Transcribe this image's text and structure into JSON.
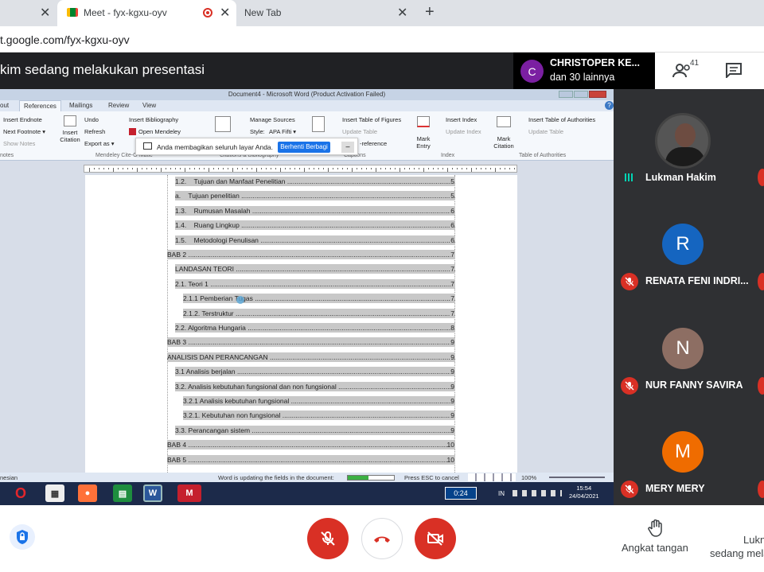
{
  "browser": {
    "tabs": [
      {
        "label": "",
        "active": false
      },
      {
        "label": "Meet - fyx-kgxu-oyv",
        "active": true
      },
      {
        "label": "New Tab",
        "active": false
      }
    ],
    "close_glyph": "✕",
    "new_tab_glyph": "+",
    "address": "t.google.com/fyx-kgxu-oyv"
  },
  "meet": {
    "presenting_title": "kim sedang melakukan presentasi",
    "presenter_chip": {
      "avatar_letter": "C",
      "name": "CHRISTOPER KE...",
      "sub": "dan 30 lainnya",
      "color": "#7b1fa2"
    },
    "participant_count": "41",
    "participants": [
      {
        "name": "Lukman Hakim",
        "avatar_letter": "",
        "color": "#444",
        "muted": false
      },
      {
        "name": "RENATA FENI INDRI...",
        "avatar_letter": "R",
        "color": "#1565c0",
        "muted": true
      },
      {
        "name": "NUR FANNY SAVIRA",
        "avatar_letter": "N",
        "color": "#8d6e63",
        "muted": true
      },
      {
        "name": "MERY MERY",
        "avatar_letter": "M",
        "color": "#ef6c00",
        "muted": true
      }
    ],
    "raise_hand_label": "Angkat tangan",
    "right_clip_line1": "Lukn",
    "right_clip_line2": "sedang mela"
  },
  "word": {
    "title": "Document4 - Microsoft Word (Product Activation Failed)",
    "tabs": [
      "out",
      "References",
      "Mailings",
      "Review",
      "View"
    ],
    "ribbon": {
      "insert_endnote": "Insert Endnote",
      "next_footnote": "Next Footnote ▾",
      "show_notes": "Show Notes",
      "group_footnotes": "notes",
      "insert_citation": "Insert Citation",
      "undo": "Undo",
      "refresh": "Refresh",
      "export_as": "Export as ▾",
      "insert_bibliography": "Insert Bibliography",
      "open_mendeley": "Open Mendeley",
      "group_mendeley": "Mendeley Cite-O-Matic",
      "manage_sources": "Manage Sources",
      "style": "Style:",
      "style_value": "APA Fifti ▾",
      "group_citations": "Citations & Bibliography",
      "insert_table_of_figures": "Insert Table of Figures",
      "update_table": "Update Table",
      "cross_reference": "-reference",
      "group_captions": "Captions",
      "mark_entry": "Mark Entry",
      "insert_index": "Insert Index",
      "update_index": "Update Index",
      "group_index": "Index",
      "mark_citation": "Mark Citation",
      "insert_table_authorities": "Insert Table of Authorities",
      "update_table2": "Update Table",
      "group_authorities": "Table of Authorities"
    },
    "share_notice": "Anda membagikan seluruh layar Anda.",
    "share_stop": "Berhenti Berbagi",
    "share_minimize": "–",
    "toc": [
      {
        "text": "1.2.    Tujuan dan Manfaat Penelitian",
        "page": "5",
        "indent": 1
      },
      {
        "text": "a.    Tujuan penelitian",
        "page": "5",
        "indent": 1
      },
      {
        "text": "1.3.    Rumusan Masalah",
        "page": "6",
        "indent": 1
      },
      {
        "text": "1.4.    Ruang Lingkup",
        "page": "6",
        "indent": 1
      },
      {
        "text": "1.5.    Metodologi Penulisan",
        "page": "6",
        "indent": 1
      },
      {
        "text": "BAB 2",
        "page": "7",
        "indent": 0
      },
      {
        "text": "LANDASAN TEORI",
        "page": "7",
        "indent": 1
      },
      {
        "text": "2.1. Teori 1",
        "page": "7",
        "indent": 1
      },
      {
        "text": "2.1.1 Pemberian Tugas",
        "page": "7",
        "indent": 2
      },
      {
        "text": "2.1.2. Terstruktur",
        "page": "7",
        "indent": 2
      },
      {
        "text": "2.2. Algoritma Hungaria",
        "page": "8",
        "indent": 1
      },
      {
        "text": "BAB 3",
        "page": "9",
        "indent": 0
      },
      {
        "text": "ANALISIS DAN PERANCANGAN",
        "page": "9",
        "indent": 0
      },
      {
        "text": "3.1 Analisis berjalan",
        "page": "9",
        "indent": 1
      },
      {
        "text": "3.2. Analisis kebutuhan fungsional dan non fungsional",
        "page": "9",
        "indent": 1
      },
      {
        "text": "3.2.1 Analisis kebutuhan fungsional",
        "page": "9",
        "indent": 2
      },
      {
        "text": "3.2.1. Kebutuhan non fungsional",
        "page": "9",
        "indent": 2
      },
      {
        "text": "3.3. Perancangan sistem",
        "page": "9",
        "indent": 1
      },
      {
        "text": "BAB 4",
        "page": "10",
        "indent": 0
      },
      {
        "text": "BAB 5",
        "page": "10",
        "indent": 0
      }
    ],
    "status_left": "nesian",
    "status_updating": "Word is updating the fields in the document:",
    "status_progress": 0.45,
    "status_esc": "Press ESC to cancel",
    "zoom": "100%",
    "taskbar_timer": "0:24",
    "taskbar_lang": "IN",
    "clock_time": "15:54",
    "clock_date": "24/04/2021"
  },
  "colors": {
    "meet_red": "#d93025",
    "word_blue": "#2b579a"
  }
}
